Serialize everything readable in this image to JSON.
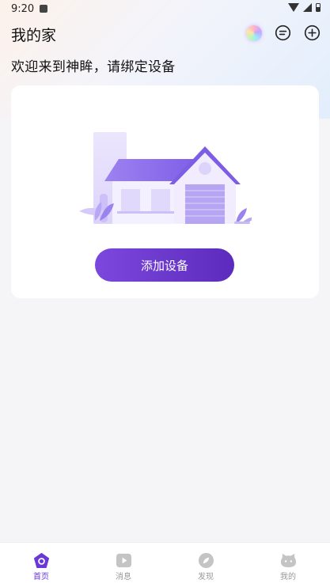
{
  "status_bar": {
    "time": "9:20"
  },
  "header": {
    "title": "我的家"
  },
  "welcome_text": "欢迎来到神眸，请绑定设备",
  "empty_card": {
    "add_device_label": "添加设备"
  },
  "tabbar": {
    "items": [
      {
        "label": "首页",
        "icon": "home-icon",
        "active": true
      },
      {
        "label": "消息",
        "icon": "message-play-icon",
        "active": false
      },
      {
        "label": "发现",
        "icon": "discover-icon",
        "active": false
      },
      {
        "label": "我的",
        "icon": "profile-icon",
        "active": false
      }
    ]
  },
  "colors": {
    "accent": "#6a38d9",
    "inactive": "#999999",
    "background": "#f5f5f7"
  }
}
